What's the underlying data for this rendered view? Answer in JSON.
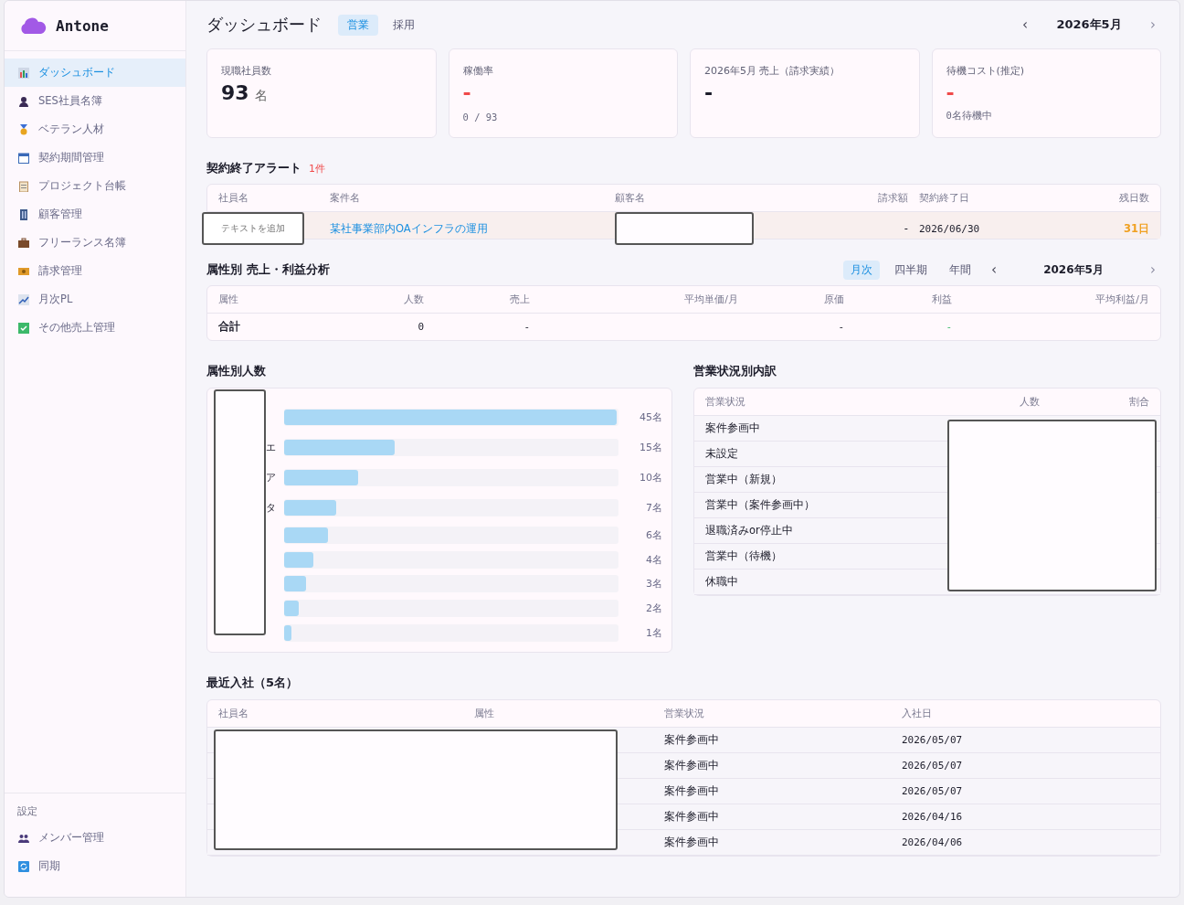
{
  "brand": "Antone",
  "sidebar": {
    "items": [
      {
        "label": "ダッシュボード",
        "selected": true
      },
      {
        "label": "SES社員名簿",
        "selected": false
      },
      {
        "label": "ベテラン人材",
        "selected": false
      },
      {
        "label": "契約期間管理",
        "selected": false
      },
      {
        "label": "プロジェクト台帳",
        "selected": false
      },
      {
        "label": "顧客管理",
        "selected": false
      },
      {
        "label": "フリーランス名簿",
        "selected": false
      },
      {
        "label": "請求管理",
        "selected": false
      },
      {
        "label": "月次PL",
        "selected": false
      },
      {
        "label": "その他売上管理",
        "selected": false
      }
    ],
    "settings_heading": "設定",
    "settings_items": [
      {
        "label": "メンバー管理",
        "selected": false
      },
      {
        "label": "同期",
        "selected": false
      }
    ]
  },
  "header": {
    "title": "ダッシュボード",
    "tabs": [
      {
        "label": "営業",
        "selected": true
      },
      {
        "label": "採用",
        "selected": false
      }
    ],
    "prev": "‹",
    "month": "2026年5月",
    "next": "›"
  },
  "stats": [
    {
      "label": "現職社員数",
      "value": "93",
      "unit": "名",
      "alert": false
    },
    {
      "label": "稼働率",
      "value": "-",
      "sub": "0 / 93",
      "alert": true
    },
    {
      "label": "2026年5月 売上（請求実績）",
      "value": "-",
      "alert": false
    },
    {
      "label": "待機コスト(推定)",
      "value": "-",
      "sub": "0名待機中",
      "alert": true
    }
  ],
  "alert": {
    "title": "契約終了アラート",
    "count": "1件",
    "columns": [
      "社員名",
      "案件名",
      "顧客名",
      "請求額",
      "契約終了日",
      "残日数"
    ],
    "rows": [
      {
        "redaction_label": "テキストを追加",
        "project": "某社事業部内OAインフラの運用",
        "amount": "-",
        "end_date": "2026/06/30",
        "days_left": "31日"
      }
    ]
  },
  "analysis": {
    "title": "属性別 売上・利益分析",
    "periods": [
      {
        "label": "月次",
        "selected": true
      },
      {
        "label": "四半期",
        "selected": false
      },
      {
        "label": "年間",
        "selected": false
      }
    ],
    "prev": "‹",
    "month": "2026年5月",
    "next": "›",
    "columns": [
      "属性",
      "人数",
      "売上",
      "平均単価/月",
      "原価",
      "利益",
      "平均利益/月"
    ],
    "total": {
      "label": "合計",
      "headcount": "0",
      "sales": "-",
      "cost": "-",
      "profit": "-"
    }
  },
  "headcount": {
    "title": "属性別人数",
    "rows": [
      {
        "count": "45名",
        "level": 1
      },
      {
        "label": "エ",
        "count": "15名",
        "level": 0.333
      },
      {
        "label": "ア",
        "count": "10名",
        "level": 0.222
      },
      {
        "label": "タ",
        "count": "7名",
        "level": 0.156
      },
      {
        "count": "6名",
        "level": 0.133
      },
      {
        "count": "4名",
        "level": 0.089
      },
      {
        "count": "3名",
        "level": 0.067
      },
      {
        "count": "2名",
        "level": 0.044
      },
      {
        "count": "1名",
        "level": 0.022
      }
    ]
  },
  "status_breakdown": {
    "title": "営業状況別内訳",
    "columns": [
      "営業状況",
      "人数",
      "割合"
    ],
    "rows": [
      "案件参画中",
      "未設定",
      "営業中（新規）",
      "営業中（案件参画中）",
      "退職済みor停止中",
      "営業中（待機）",
      "休職中"
    ]
  },
  "recent": {
    "title": "最近入社（5名）",
    "columns": [
      "社員名",
      "属性",
      "営業状況",
      "入社日"
    ],
    "rows": [
      {
        "status": "案件参画中",
        "date": "2026/05/07"
      },
      {
        "status": "案件参画中",
        "date": "2026/05/07"
      },
      {
        "status": "案件参画中",
        "date": "2026/05/07"
      },
      {
        "status": "案件参画中",
        "date": "2026/04/16"
      },
      {
        "status": "案件参画中",
        "date": "2026/04/06"
      }
    ]
  }
}
